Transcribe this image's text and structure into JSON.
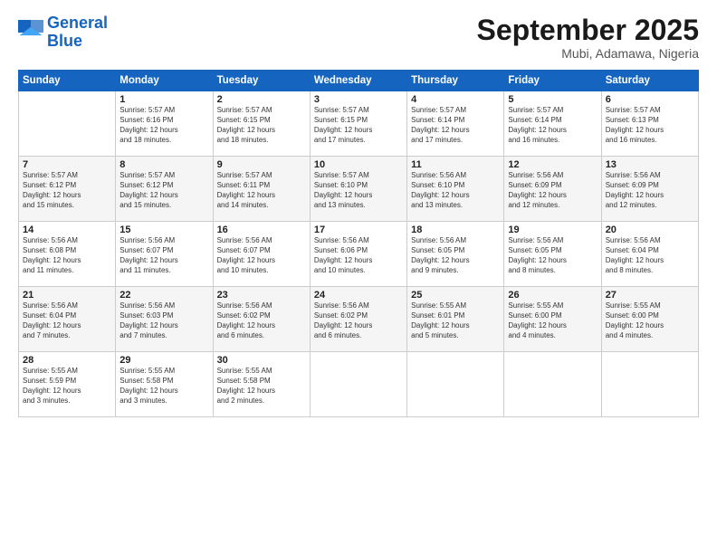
{
  "header": {
    "logo_line1": "General",
    "logo_line2": "Blue",
    "month": "September 2025",
    "location": "Mubi, Adamawa, Nigeria"
  },
  "weekdays": [
    "Sunday",
    "Monday",
    "Tuesday",
    "Wednesday",
    "Thursday",
    "Friday",
    "Saturday"
  ],
  "weeks": [
    [
      {
        "day": "",
        "text": ""
      },
      {
        "day": "1",
        "text": "Sunrise: 5:57 AM\nSunset: 6:16 PM\nDaylight: 12 hours\nand 18 minutes."
      },
      {
        "day": "2",
        "text": "Sunrise: 5:57 AM\nSunset: 6:15 PM\nDaylight: 12 hours\nand 18 minutes."
      },
      {
        "day": "3",
        "text": "Sunrise: 5:57 AM\nSunset: 6:15 PM\nDaylight: 12 hours\nand 17 minutes."
      },
      {
        "day": "4",
        "text": "Sunrise: 5:57 AM\nSunset: 6:14 PM\nDaylight: 12 hours\nand 17 minutes."
      },
      {
        "day": "5",
        "text": "Sunrise: 5:57 AM\nSunset: 6:14 PM\nDaylight: 12 hours\nand 16 minutes."
      },
      {
        "day": "6",
        "text": "Sunrise: 5:57 AM\nSunset: 6:13 PM\nDaylight: 12 hours\nand 16 minutes."
      }
    ],
    [
      {
        "day": "7",
        "text": "Sunrise: 5:57 AM\nSunset: 6:12 PM\nDaylight: 12 hours\nand 15 minutes."
      },
      {
        "day": "8",
        "text": "Sunrise: 5:57 AM\nSunset: 6:12 PM\nDaylight: 12 hours\nand 15 minutes."
      },
      {
        "day": "9",
        "text": "Sunrise: 5:57 AM\nSunset: 6:11 PM\nDaylight: 12 hours\nand 14 minutes."
      },
      {
        "day": "10",
        "text": "Sunrise: 5:57 AM\nSunset: 6:10 PM\nDaylight: 12 hours\nand 13 minutes."
      },
      {
        "day": "11",
        "text": "Sunrise: 5:56 AM\nSunset: 6:10 PM\nDaylight: 12 hours\nand 13 minutes."
      },
      {
        "day": "12",
        "text": "Sunrise: 5:56 AM\nSunset: 6:09 PM\nDaylight: 12 hours\nand 12 minutes."
      },
      {
        "day": "13",
        "text": "Sunrise: 5:56 AM\nSunset: 6:09 PM\nDaylight: 12 hours\nand 12 minutes."
      }
    ],
    [
      {
        "day": "14",
        "text": "Sunrise: 5:56 AM\nSunset: 6:08 PM\nDaylight: 12 hours\nand 11 minutes."
      },
      {
        "day": "15",
        "text": "Sunrise: 5:56 AM\nSunset: 6:07 PM\nDaylight: 12 hours\nand 11 minutes."
      },
      {
        "day": "16",
        "text": "Sunrise: 5:56 AM\nSunset: 6:07 PM\nDaylight: 12 hours\nand 10 minutes."
      },
      {
        "day": "17",
        "text": "Sunrise: 5:56 AM\nSunset: 6:06 PM\nDaylight: 12 hours\nand 10 minutes."
      },
      {
        "day": "18",
        "text": "Sunrise: 5:56 AM\nSunset: 6:05 PM\nDaylight: 12 hours\nand 9 minutes."
      },
      {
        "day": "19",
        "text": "Sunrise: 5:56 AM\nSunset: 6:05 PM\nDaylight: 12 hours\nand 8 minutes."
      },
      {
        "day": "20",
        "text": "Sunrise: 5:56 AM\nSunset: 6:04 PM\nDaylight: 12 hours\nand 8 minutes."
      }
    ],
    [
      {
        "day": "21",
        "text": "Sunrise: 5:56 AM\nSunset: 6:04 PM\nDaylight: 12 hours\nand 7 minutes."
      },
      {
        "day": "22",
        "text": "Sunrise: 5:56 AM\nSunset: 6:03 PM\nDaylight: 12 hours\nand 7 minutes."
      },
      {
        "day": "23",
        "text": "Sunrise: 5:56 AM\nSunset: 6:02 PM\nDaylight: 12 hours\nand 6 minutes."
      },
      {
        "day": "24",
        "text": "Sunrise: 5:56 AM\nSunset: 6:02 PM\nDaylight: 12 hours\nand 6 minutes."
      },
      {
        "day": "25",
        "text": "Sunrise: 5:55 AM\nSunset: 6:01 PM\nDaylight: 12 hours\nand 5 minutes."
      },
      {
        "day": "26",
        "text": "Sunrise: 5:55 AM\nSunset: 6:00 PM\nDaylight: 12 hours\nand 4 minutes."
      },
      {
        "day": "27",
        "text": "Sunrise: 5:55 AM\nSunset: 6:00 PM\nDaylight: 12 hours\nand 4 minutes."
      }
    ],
    [
      {
        "day": "28",
        "text": "Sunrise: 5:55 AM\nSunset: 5:59 PM\nDaylight: 12 hours\nand 3 minutes."
      },
      {
        "day": "29",
        "text": "Sunrise: 5:55 AM\nSunset: 5:58 PM\nDaylight: 12 hours\nand 3 minutes."
      },
      {
        "day": "30",
        "text": "Sunrise: 5:55 AM\nSunset: 5:58 PM\nDaylight: 12 hours\nand 2 minutes."
      },
      {
        "day": "",
        "text": ""
      },
      {
        "day": "",
        "text": ""
      },
      {
        "day": "",
        "text": ""
      },
      {
        "day": "",
        "text": ""
      }
    ]
  ]
}
